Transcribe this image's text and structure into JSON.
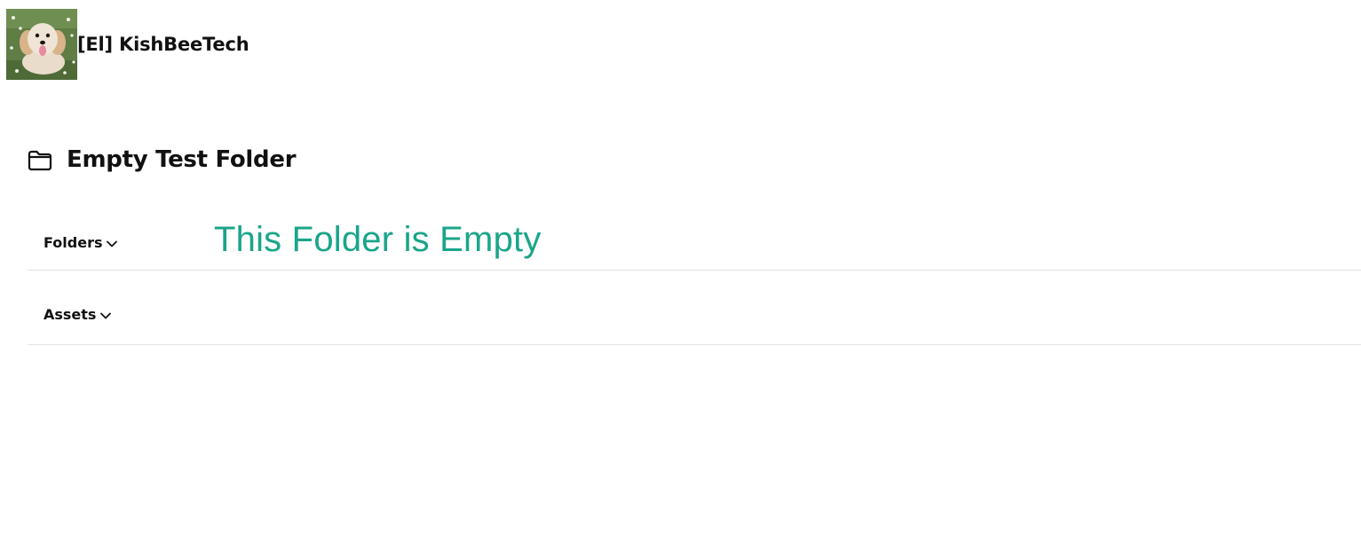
{
  "header": {
    "avatar_alt": "fluffy white dog lying in grass",
    "brand_name": "[El] KishBeeTech"
  },
  "folder": {
    "icon": "folder-icon",
    "title": "Empty Test Folder"
  },
  "sections": {
    "folders": {
      "label": "Folders",
      "icon": "chevron-down-icon",
      "empty_message": "This Folder is Empty"
    },
    "assets": {
      "label": "Assets",
      "icon": "chevron-down-icon"
    }
  },
  "colors": {
    "empty_message": "#1aa58a",
    "divider": "#e3e3e3",
    "text": "#111111"
  }
}
